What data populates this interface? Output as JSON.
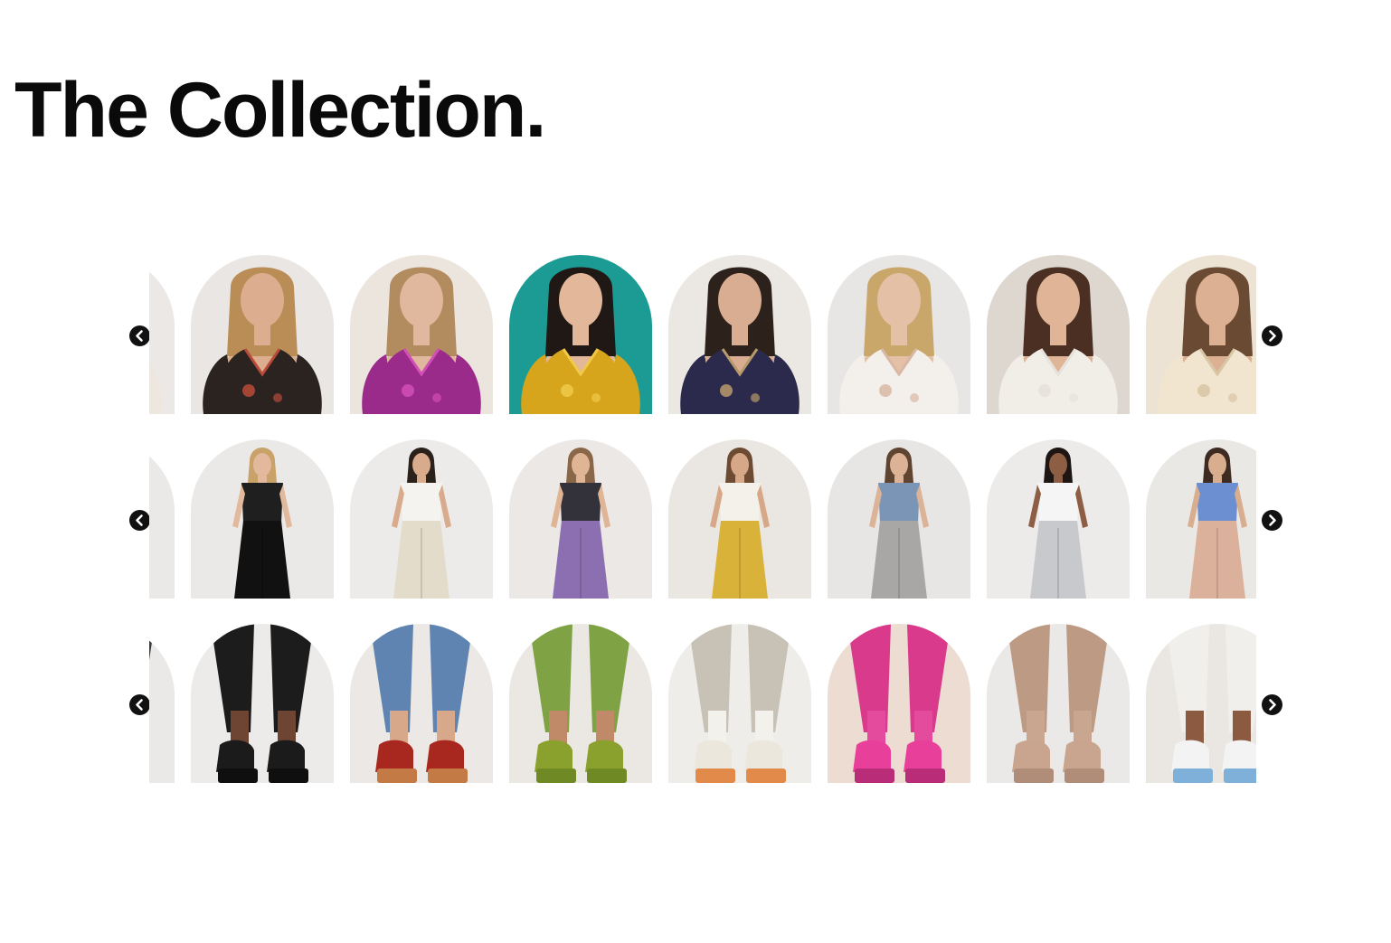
{
  "page": {
    "title": "The Collection."
  },
  "carousels": [
    {
      "name": "tops",
      "prev_icon": "chevron-left-circle-icon",
      "next_icon": "chevron-right-circle-icon",
      "items": [
        {
          "kind": "top",
          "bg": "#ebe8e6",
          "skin": "#d6a98e",
          "hair": "#5a3d2c",
          "garment": "#ede7df",
          "accent": "#c8b9a6"
        },
        {
          "kind": "top",
          "bg": "#e9e6e3",
          "skin": "#dcae8f",
          "hair": "#b98d55",
          "garment": "#2a2320",
          "accent": "#b84a3a"
        },
        {
          "kind": "top",
          "bg": "#ece5de",
          "skin": "#e0b89d",
          "hair": "#b28b5f",
          "garment": "#9a2b8a",
          "accent": "#d24fb6"
        },
        {
          "kind": "top",
          "bg": "#1b9b93",
          "skin": "#e2b79a",
          "hair": "#1f1814",
          "garment": "#d6a51c",
          "accent": "#f0c94a"
        },
        {
          "kind": "top",
          "bg": "#ebe7e3",
          "skin": "#d9ad92",
          "hair": "#2c211b",
          "garment": "#2b2a4c",
          "accent": "#b89a6a"
        },
        {
          "kind": "top",
          "bg": "#e8e6e4",
          "skin": "#e4c0a6",
          "hair": "#c9a66a",
          "garment": "#f3f0eb",
          "accent": "#d9b7a4"
        },
        {
          "kind": "top",
          "bg": "#ddd7d0",
          "skin": "#dfb497",
          "hair": "#4a2f22",
          "garment": "#f1eee8",
          "accent": "#e6e2da"
        },
        {
          "kind": "top",
          "bg": "#ece3d5",
          "skin": "#dcb092",
          "hair": "#6b4a34",
          "garment": "#f1e5cf",
          "accent": "#d9c6a5"
        }
      ]
    },
    {
      "name": "bottoms",
      "prev_icon": "chevron-left-circle-icon",
      "next_icon": "chevron-right-circle-icon",
      "items": [
        {
          "kind": "bottom",
          "bg": "#ebe9e7",
          "skin": "#e1b99c",
          "hair": "#c9a675",
          "garment": "#cfe0ea",
          "accent": "#f4f1ec"
        },
        {
          "kind": "bottom",
          "bg": "#ebe9e7",
          "skin": "#e2b99c",
          "hair": "#c9a26a",
          "garment": "#111111",
          "accent": "#1f1f1f"
        },
        {
          "kind": "bottom",
          "bg": "#ecebe9",
          "skin": "#d8ab8c",
          "hair": "#2b211b",
          "garment": "#e3dccb",
          "accent": "#f5f3ef"
        },
        {
          "kind": "bottom",
          "bg": "#ebe8e6",
          "skin": "#e0b596",
          "hair": "#8a6748",
          "garment": "#8b6fb0",
          "accent": "#33323a"
        },
        {
          "kind": "bottom",
          "bg": "#eae6e1",
          "skin": "#d7a887",
          "hair": "#6d4b33",
          "garment": "#d9b23a",
          "accent": "#f4f1ea"
        },
        {
          "kind": "bottom",
          "bg": "#e7e6e5",
          "skin": "#dcb396",
          "hair": "#5f4431",
          "garment": "#a9a7a5",
          "accent": "#7b95b6"
        },
        {
          "kind": "bottom",
          "bg": "#ecebea",
          "skin": "#8d5d44",
          "hair": "#1d1612",
          "garment": "#c8c9cc",
          "accent": "#f5f5f5"
        },
        {
          "kind": "bottom",
          "bg": "#eae8e5",
          "skin": "#d9ae8f",
          "hair": "#3d2a20",
          "garment": "#dcb19c",
          "accent": "#6b8fd0"
        }
      ]
    },
    {
      "name": "shoes",
      "prev_icon": "chevron-left-circle-icon",
      "next_icon": "chevron-right-circle-icon",
      "items": [
        {
          "kind": "shoe",
          "bg": "#ebe9e7",
          "skin": "#e6e2dc",
          "hair": "#3a3a3a",
          "garment": "#6e6c68",
          "accent": "#222222"
        },
        {
          "kind": "shoe",
          "bg": "#ecebe9",
          "skin": "#6e4532",
          "hair": "#1c1c1c",
          "garment": "#1b1b1b",
          "accent": "#0f0f0f"
        },
        {
          "kind": "shoe",
          "bg": "#ebe8e5",
          "skin": "#d7a98a",
          "hair": "#5f84b1",
          "garment": "#a8271f",
          "accent": "#c37a45"
        },
        {
          "kind": "shoe",
          "bg": "#ebe8e3",
          "skin": "#c08a68",
          "hair": "#7ea244",
          "garment": "#8ba12d",
          "accent": "#6f8a24"
        },
        {
          "kind": "shoe",
          "bg": "#efedea",
          "skin": "#f3f1ec",
          "hair": "#c7c1b6",
          "garment": "#ece7dd",
          "accent": "#e28a4a"
        },
        {
          "kind": "shoe",
          "bg": "#eddcd2",
          "skin": "#e54b9c",
          "hair": "#d93a8c",
          "garment": "#e8409a",
          "accent": "#b82c78"
        },
        {
          "kind": "shoe",
          "bg": "#ebe9e7",
          "skin": "#c8a690",
          "hair": "#bd9a84",
          "garment": "#c9a48f",
          "accent": "#b08d78"
        },
        {
          "kind": "shoe",
          "bg": "#eae7e3",
          "skin": "#8b5a40",
          "hair": "#f1efec",
          "garment": "#f3f3f3",
          "accent": "#7fb0d9"
        }
      ]
    }
  ]
}
